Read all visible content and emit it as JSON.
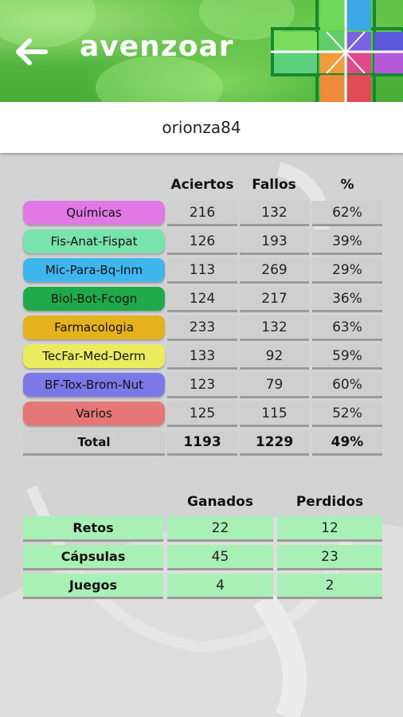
{
  "header": {
    "title": "avenzoar",
    "back_icon": "back-arrow-icon",
    "logo_icon": "avenzoar-cross-logo"
  },
  "user": {
    "name": "orionza84"
  },
  "stats": {
    "columns": [
      "Aciertos",
      "Fallos",
      "%"
    ],
    "rows": [
      {
        "label": "Químicas",
        "color": "#e079e6",
        "aciertos": "216",
        "fallos": "132",
        "pct": "62%"
      },
      {
        "label": "Fis-Anat-Fispat",
        "color": "#79e3ae",
        "aciertos": "126",
        "fallos": "193",
        "pct": "39%"
      },
      {
        "label": "Mic-Para-Bq-Inm",
        "color": "#40b6ee",
        "aciertos": "113",
        "fallos": "269",
        "pct": "29%"
      },
      {
        "label": "Biol-Bot-Fcogn",
        "color": "#1fab4a",
        "aciertos": "124",
        "fallos": "217",
        "pct": "36%"
      },
      {
        "label": "Farmacologia",
        "color": "#e6b21c",
        "aciertos": "233",
        "fallos": "132",
        "pct": "63%"
      },
      {
        "label": "TecFar-Med-Derm",
        "color": "#ebeb60",
        "aciertos": "133",
        "fallos": "92",
        "pct": "59%"
      },
      {
        "label": "BF-Tox-Brom-Nut",
        "color": "#7c78e8",
        "aciertos": "123",
        "fallos": "79",
        "pct": "60%"
      },
      {
        "label": "Varios",
        "color": "#e57777",
        "aciertos": "125",
        "fallos": "115",
        "pct": "52%"
      }
    ],
    "total": {
      "label": "Total",
      "aciertos": "1193",
      "fallos": "1229",
      "pct": "49%"
    }
  },
  "games": {
    "columns": [
      "Ganados",
      "Perdidos"
    ],
    "rows": [
      {
        "label": "Retos",
        "ganados": "22",
        "perdidos": "12"
      },
      {
        "label": "Cápsulas",
        "ganados": "45",
        "perdidos": "23"
      },
      {
        "label": "Juegos",
        "ganados": "4",
        "perdidos": "2"
      }
    ]
  }
}
